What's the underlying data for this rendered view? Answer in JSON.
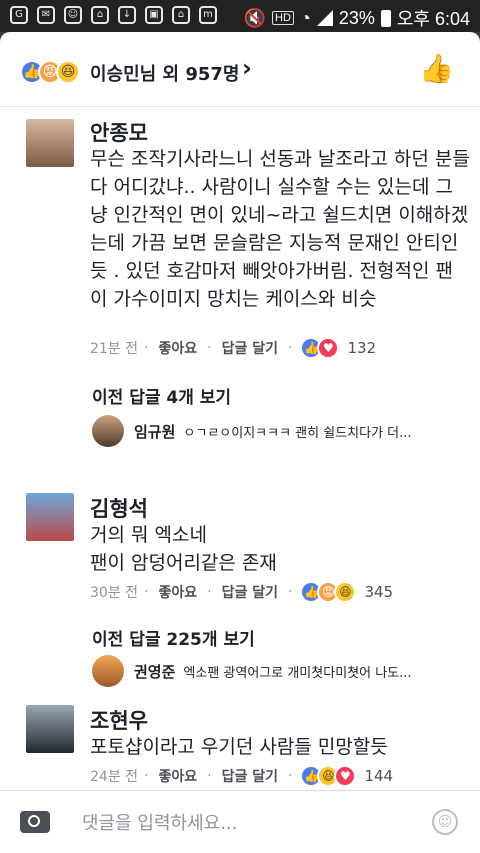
{
  "status": {
    "battery": "23%",
    "time": "오후 6:04",
    "net": "HD"
  },
  "header": {
    "reactors": "이승민님 외 957명"
  },
  "comments": [
    {
      "name": "안종모",
      "text": "무슨 조작기사라느니 선동과 날조라고 하던 분들 다 어디갔냐.. 사람이니 실수할 수는 있는데 그냥 인간적인 면이 있네~라고 쉴드치면 이해하겠는데 가끔 보면 문슬람은 지능적 문재인 안티인듯 . 있던 호감마저 빼앗아가버림. 전형적인 팬이 가수이미지 망치는 케이스와 비슷",
      "time": "21분 전",
      "like_label": "좋아요",
      "reply_label": "답글 달기",
      "reaction_count": "132",
      "more_replies": "이전 답글 4개 보기",
      "reply_name": "임규원",
      "reply_text": "ㅇㄱㄹㅇ이지ㅋㅋㅋ 괜히 쉴드치다가 더..."
    },
    {
      "name": "김형석",
      "text": "거의 뭐 엑소네\n팬이 암덩어리같은 존재",
      "time": "30분 전",
      "like_label": "좋아요",
      "reply_label": "답글 달기",
      "reaction_count": "345",
      "more_replies": "이전 답글 225개 보기",
      "reply_name": "권영준",
      "reply_text": "엑소팬 광역어그로 개미쳣다미쳣어 나도..."
    },
    {
      "name": "조현우",
      "text": "포토샵이라고 우기던 사람들 민망할듯",
      "time": "24분 전",
      "like_label": "좋아요",
      "reply_label": "답글 달기",
      "reaction_count": "144"
    }
  ],
  "composer": {
    "placeholder": "댓글을 입력하세요..."
  },
  "colors": {
    "like": "#4a7bf0",
    "love": "#f23c5a",
    "haha": "#f7c62f",
    "angry": "#f4a24c"
  },
  "icons": {
    "camera": "camera-icon",
    "emoji": "emoji-icon",
    "like": "thumbs-up-icon"
  }
}
